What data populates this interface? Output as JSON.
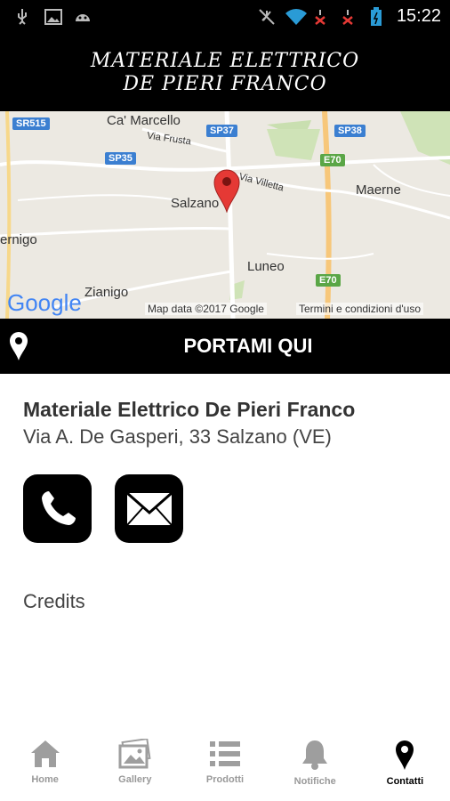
{
  "status_bar": {
    "time": "15:22"
  },
  "header": {
    "logo_line1": "MATERIALE ELETTRICO",
    "logo_line2": "DE PIERI FRANCO"
  },
  "map": {
    "places": [
      "Ca' Marcello",
      "Via Frusta",
      "Salzano",
      "Via Villetta",
      "Maerne",
      "Luneo",
      "Zianigo",
      "ernigo"
    ],
    "roads": [
      "SR515",
      "SP37",
      "SP38",
      "SP35",
      "E70",
      "E70"
    ],
    "attribution": "Map data ©2017 Google",
    "terms": "Termini e condizioni d'uso",
    "google_logo": "Google"
  },
  "portami": {
    "label": "PORTAMI QUI"
  },
  "contact": {
    "company": "Materiale Elettrico De Pieri Franco",
    "address": "Via A. De Gasperi, 33 Salzano (VE)"
  },
  "credits": "Credits",
  "tabs": [
    {
      "label": "Home",
      "icon": "home-icon"
    },
    {
      "label": "Gallery",
      "icon": "gallery-icon"
    },
    {
      "label": "Prodotti",
      "icon": "list-icon"
    },
    {
      "label": "Notifiche",
      "icon": "bell-icon"
    },
    {
      "label": "Contatti",
      "icon": "pin-icon"
    }
  ],
  "colors": {
    "accent": "#000000",
    "map_marker": "#e53935",
    "tab_inactive": "#999999"
  }
}
